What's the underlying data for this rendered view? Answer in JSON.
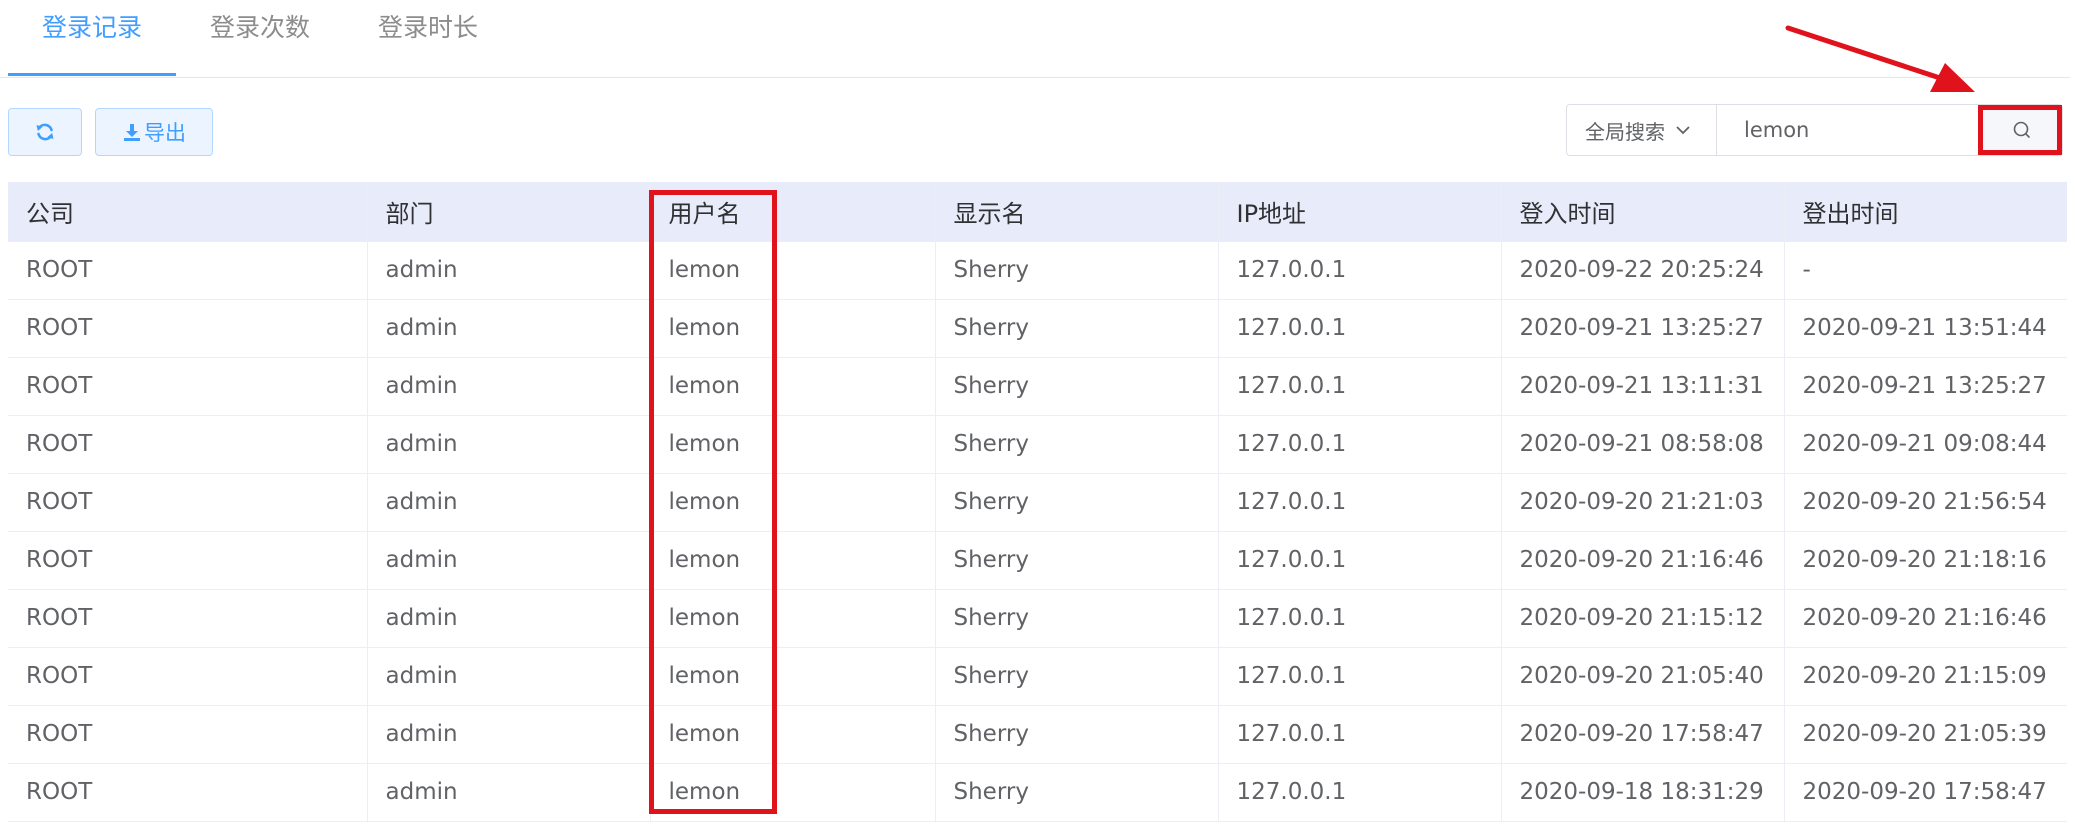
{
  "tabs": [
    {
      "label": "登录记录",
      "active": true
    },
    {
      "label": "登录次数",
      "active": false
    },
    {
      "label": "登录时长",
      "active": false
    }
  ],
  "toolbar": {
    "refresh_icon": "refresh-icon",
    "export_icon": "download-icon",
    "export_label": "导出"
  },
  "search": {
    "scope_label": "全局搜索",
    "value": "lemon",
    "button_icon": "search-icon"
  },
  "table": {
    "columns": [
      "公司",
      "部门",
      "用户名",
      "显示名",
      "IP地址",
      "登入时间",
      "登出时间"
    ],
    "rows": [
      [
        "ROOT",
        "admin",
        "lemon",
        "Sherry",
        "127.0.0.1",
        "2020-09-22 20:25:24",
        "-"
      ],
      [
        "ROOT",
        "admin",
        "lemon",
        "Sherry",
        "127.0.0.1",
        "2020-09-21 13:25:27",
        "2020-09-21 13:51:44"
      ],
      [
        "ROOT",
        "admin",
        "lemon",
        "Sherry",
        "127.0.0.1",
        "2020-09-21 13:11:31",
        "2020-09-21 13:25:27"
      ],
      [
        "ROOT",
        "admin",
        "lemon",
        "Sherry",
        "127.0.0.1",
        "2020-09-21 08:58:08",
        "2020-09-21 09:08:44"
      ],
      [
        "ROOT",
        "admin",
        "lemon",
        "Sherry",
        "127.0.0.1",
        "2020-09-20 21:21:03",
        "2020-09-20 21:56:54"
      ],
      [
        "ROOT",
        "admin",
        "lemon",
        "Sherry",
        "127.0.0.1",
        "2020-09-20 21:16:46",
        "2020-09-20 21:18:16"
      ],
      [
        "ROOT",
        "admin",
        "lemon",
        "Sherry",
        "127.0.0.1",
        "2020-09-20 21:15:12",
        "2020-09-20 21:16:46"
      ],
      [
        "ROOT",
        "admin",
        "lemon",
        "Sherry",
        "127.0.0.1",
        "2020-09-20 21:05:40",
        "2020-09-20 21:15:09"
      ],
      [
        "ROOT",
        "admin",
        "lemon",
        "Sherry",
        "127.0.0.1",
        "2020-09-20 17:58:47",
        "2020-09-20 21:05:39"
      ],
      [
        "ROOT",
        "admin",
        "lemon",
        "Sherry",
        "127.0.0.1",
        "2020-09-18 18:31:29",
        "2020-09-20 17:58:47"
      ]
    ]
  },
  "colors": {
    "accent": "#409eff",
    "header_bg": "#e8ecfa",
    "annotation": "#e0131d"
  }
}
